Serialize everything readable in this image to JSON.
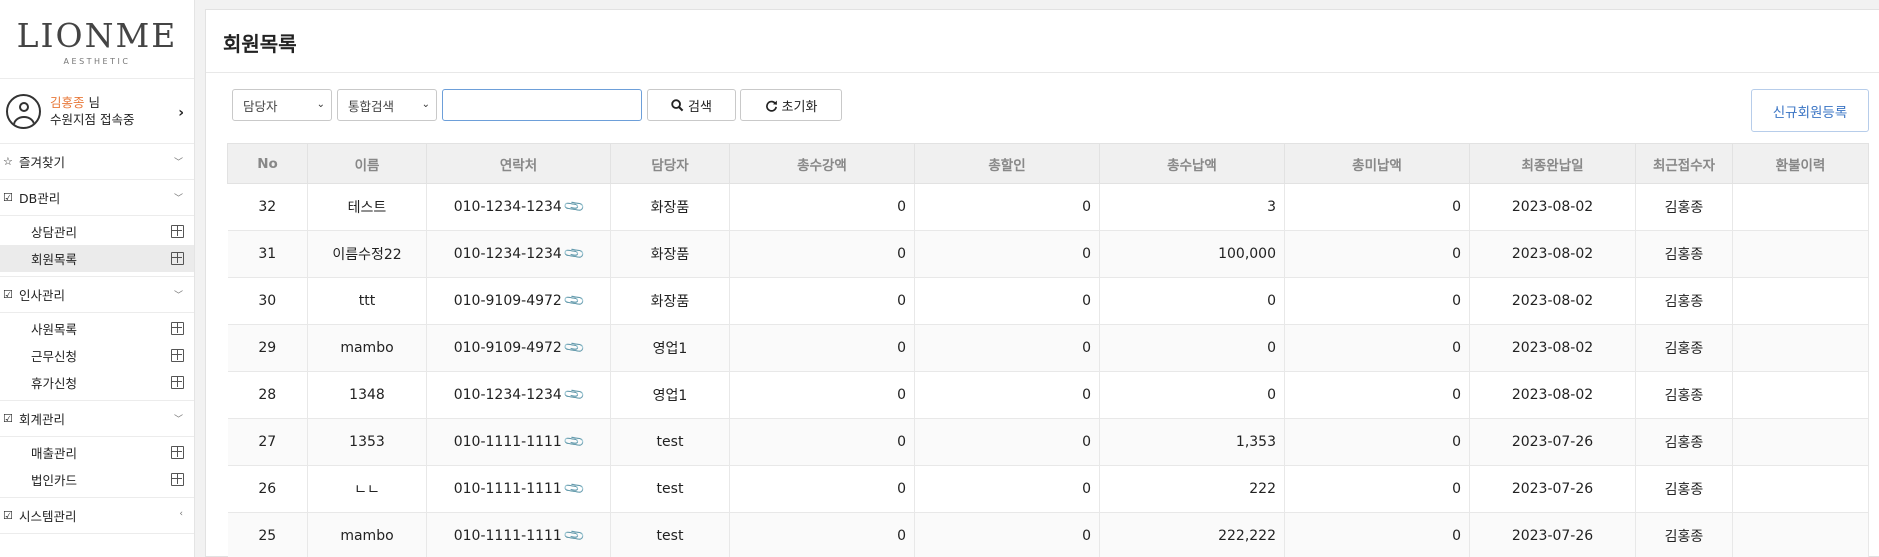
{
  "sidebar": {
    "logo_main": "LIONME",
    "logo_sub": "AESTHETIC",
    "user_name": "김홍종",
    "user_suffix": " 님",
    "user_status": "수원지점 접속중",
    "arrow": "›",
    "menus": [
      {
        "icon": "☆",
        "label": "즐겨찾기",
        "caret": "﹀",
        "items": []
      },
      {
        "icon": "☑",
        "label": "DB관리",
        "caret": "﹀",
        "items": [
          {
            "label": "상담관리",
            "active": false
          },
          {
            "label": "회원목록",
            "active": true
          }
        ]
      },
      {
        "icon": "☑",
        "label": "인사관리",
        "caret": "﹀",
        "items": [
          {
            "label": "사원목록",
            "active": false
          },
          {
            "label": "근무신청",
            "active": false
          },
          {
            "label": "휴가신청",
            "active": false
          }
        ]
      },
      {
        "icon": "☑",
        "label": "회계관리",
        "caret": "﹀",
        "items": [
          {
            "label": "매출관리",
            "active": false
          },
          {
            "label": "법인카드",
            "active": false
          }
        ]
      },
      {
        "icon": "☑",
        "label": "시스템관리",
        "caret": "‹",
        "items": []
      }
    ]
  },
  "main": {
    "title": "회원목록",
    "filters": {
      "manager_select": "담당자",
      "search_type_select": "통합검색",
      "search_value": ""
    },
    "buttons": {
      "search": "검색",
      "reset": "초기화",
      "new_member": "신규회원등록"
    },
    "table": {
      "columns": [
        "No",
        "이름",
        "연락처",
        "담당자",
        "총수강액",
        "총할인",
        "총수납액",
        "총미납액",
        "최종완납일",
        "최근접수자",
        "환불이력"
      ],
      "rows": [
        {
          "no": "32",
          "name": "테스트",
          "phone": "010-1234-1234",
          "manager": "화장품",
          "total_tuition": "0",
          "total_discount": "0",
          "total_paid": "3",
          "total_unpaid": "0",
          "last_paid_date": "2023-08-02",
          "recent_receiver": "김홍종",
          "refund": ""
        },
        {
          "no": "31",
          "name": "이름수정22",
          "phone": "010-1234-1234",
          "manager": "화장품",
          "total_tuition": "0",
          "total_discount": "0",
          "total_paid": "100,000",
          "total_unpaid": "0",
          "last_paid_date": "2023-08-02",
          "recent_receiver": "김홍종",
          "refund": ""
        },
        {
          "no": "30",
          "name": "ttt",
          "phone": "010-9109-4972",
          "manager": "화장품",
          "total_tuition": "0",
          "total_discount": "0",
          "total_paid": "0",
          "total_unpaid": "0",
          "last_paid_date": "2023-08-02",
          "recent_receiver": "김홍종",
          "refund": ""
        },
        {
          "no": "29",
          "name": "mambo",
          "phone": "010-9109-4972",
          "manager": "영업1",
          "total_tuition": "0",
          "total_discount": "0",
          "total_paid": "0",
          "total_unpaid": "0",
          "last_paid_date": "2023-08-02",
          "recent_receiver": "김홍종",
          "refund": ""
        },
        {
          "no": "28",
          "name": "1348",
          "phone": "010-1234-1234",
          "manager": "영업1",
          "total_tuition": "0",
          "total_discount": "0",
          "total_paid": "0",
          "total_unpaid": "0",
          "last_paid_date": "2023-08-02",
          "recent_receiver": "김홍종",
          "refund": ""
        },
        {
          "no": "27",
          "name": "1353",
          "phone": "010-1111-1111",
          "manager": "test",
          "total_tuition": "0",
          "total_discount": "0",
          "total_paid": "1,353",
          "total_unpaid": "0",
          "last_paid_date": "2023-07-26",
          "recent_receiver": "김홍종",
          "refund": ""
        },
        {
          "no": "26",
          "name": "ㄴㄴ",
          "phone": "010-1111-1111",
          "manager": "test",
          "total_tuition": "0",
          "total_discount": "0",
          "total_paid": "222",
          "total_unpaid": "0",
          "last_paid_date": "2023-07-26",
          "recent_receiver": "김홍종",
          "refund": ""
        },
        {
          "no": "25",
          "name": "mambo",
          "phone": "010-1111-1111",
          "manager": "test",
          "total_tuition": "0",
          "total_discount": "0",
          "total_paid": "222,222",
          "total_unpaid": "0",
          "last_paid_date": "2023-07-26",
          "recent_receiver": "김홍종",
          "refund": ""
        }
      ]
    }
  },
  "colors": {
    "accent_blue": "#3a74c4",
    "user_name_orange": "#e8793a"
  },
  "icons": {
    "user": "user-circle-icon",
    "search": "magnifier-icon",
    "reset": "refresh-icon",
    "clip": "paperclip-icon",
    "submenu": "grid-box-icon"
  }
}
